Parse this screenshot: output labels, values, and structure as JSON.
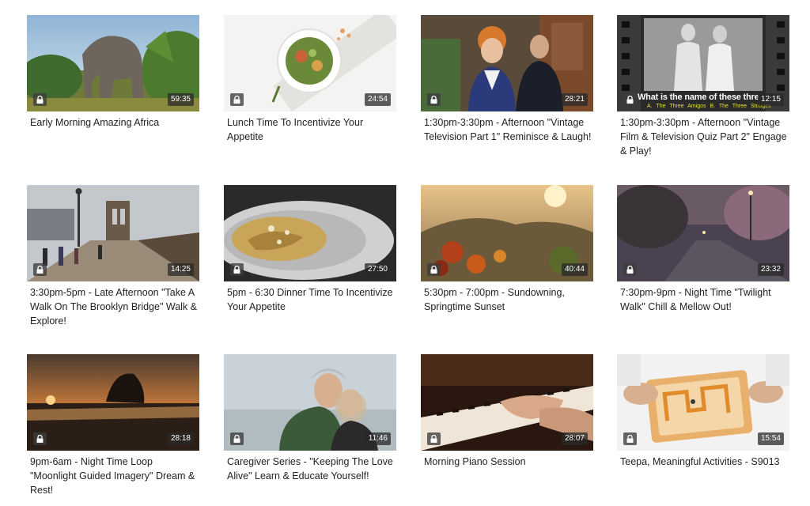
{
  "videos": [
    {
      "title": "Early Morning Amazing Africa",
      "duration": "59:35"
    },
    {
      "title": "Lunch Time To Incentivize Your Appetite",
      "duration": "24:54"
    },
    {
      "title": "1:30pm-3:30pm - Afternoon \"Vintage Television Part 1\" Reminisce & Laugh!",
      "duration": "28:21"
    },
    {
      "title": "1:30pm-3:30pm - Afternoon \"Vintage Film & Television Quiz Part 2\" Engage & Play!",
      "duration": "12:15",
      "thumb_text": "What is the name of these thre",
      "thumb_answers": "A. The Three Amigos    B. The Three Stooges"
    },
    {
      "title": "3:30pm-5pm - Late Afternoon \"Take A Walk On The Brooklyn Bridge\" Walk & Explore!",
      "duration": "14:25"
    },
    {
      "title": "5pm - 6:30 Dinner Time To Incentivize Your Appetite",
      "duration": "27:50"
    },
    {
      "title": "5:30pm - 7:00pm - Sundowning, Springtime Sunset",
      "duration": "40:44"
    },
    {
      "title": "7:30pm-9pm - Night Time \"Twilight Walk\" Chill & Mellow Out!",
      "duration": "23:32"
    },
    {
      "title": "9pm-6am - Night Time Loop \"Moonlight Guided Imagery\" Dream & Rest!",
      "duration": "28:18"
    },
    {
      "title": "Caregiver Series - \"Keeping The Love Alive\" Learn & Educate Yourself!",
      "duration": "11:46"
    },
    {
      "title": "Morning Piano Session",
      "duration": "28:07"
    },
    {
      "title": "Teepa, Meaningful Activities - S9013",
      "duration": "15:54"
    }
  ],
  "icons": {
    "lock": "lock-icon"
  }
}
